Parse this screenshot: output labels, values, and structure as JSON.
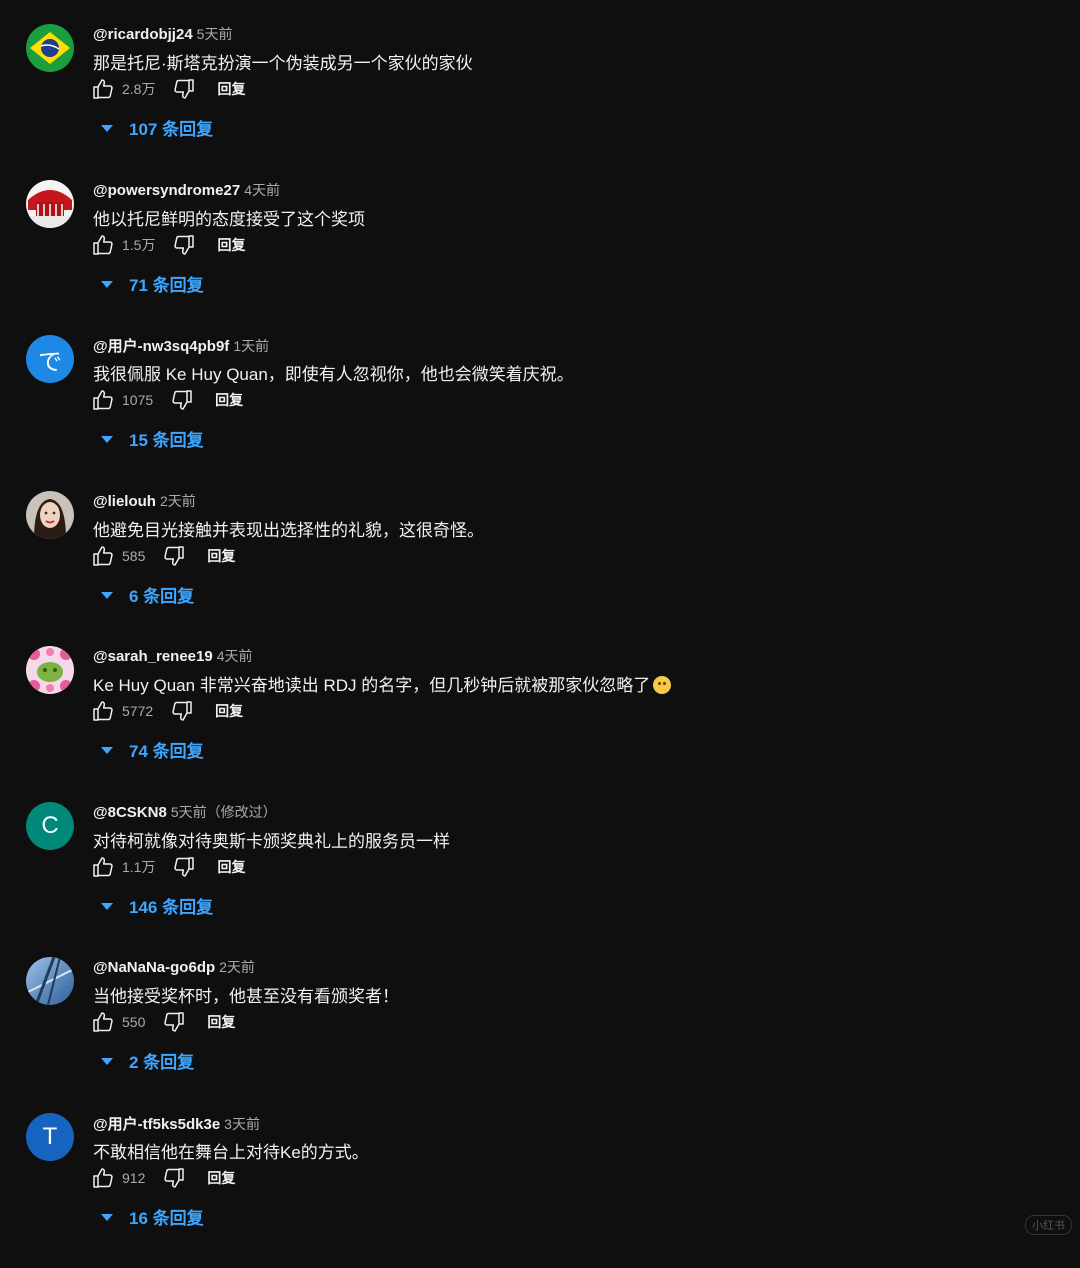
{
  "like_icon": "thumbs-up-icon",
  "dislike_icon": "thumbs-down-icon",
  "expand_icon": "caret-down-icon",
  "accent_color": "#3ea6ff",
  "background_color": "#0f0f0f",
  "watermark": "小红书",
  "comments": [
    {
      "author": "@ricardobjj24",
      "time": "5天前",
      "text": "那是托尼·斯塔克扮演一个伪装成另一个家伙的家伙",
      "likes": "2.8万",
      "reply_label": "回复",
      "replies_label": "107 条回复",
      "avatar": {
        "type": "brazil-flag"
      }
    },
    {
      "author": "@powersyndrome27",
      "time": "4天前",
      "text": "他以托尼鲜明的态度接受了这个奖项",
      "likes": "1.5万",
      "reply_label": "回复",
      "replies_label": "71 条回复",
      "avatar": {
        "type": "red-art"
      }
    },
    {
      "author": "@用户-nw3sq4pb9f",
      "time": "1天前",
      "text": "我很佩服 Ke Huy Quan，即使有人忽视你，他也会微笑着庆祝。",
      "likes": "1075",
      "reply_label": "回复",
      "replies_label": "15 条回复",
      "avatar": {
        "type": "letter",
        "letter": "で",
        "color": "#1e88e5"
      }
    },
    {
      "author": "@lielouh",
      "time": "2天前",
      "text": "他避免目光接触并表现出选择性的礼貌，这很奇怪。",
      "likes": "585",
      "reply_label": "回复",
      "replies_label": "6 条回复",
      "avatar": {
        "type": "portrait"
      }
    },
    {
      "author": "@sarah_renee19",
      "time": "4天前",
      "text": "Ke Huy Quan 非常兴奋地读出 RDJ 的名字，但几秒钟后就被那家伙忽略了",
      "has_emoji": true,
      "likes": "5772",
      "reply_label": "回复",
      "replies_label": "74 条回复",
      "avatar": {
        "type": "flowers"
      }
    },
    {
      "author": "@8CSKN8",
      "time": "5天前（修改过）",
      "text": "对待柯就像对待奥斯卡颁奖典礼上的服务员一样",
      "likes": "1.1万",
      "reply_label": "回复",
      "replies_label": "146 条回复",
      "avatar": {
        "type": "letter",
        "letter": "C",
        "color": "#00897b"
      }
    },
    {
      "author": "@NaNaNa-go6dp",
      "time": "2天前",
      "text": "当他接受奖杯时，他甚至没有看颁奖者！",
      "likes": "550",
      "reply_label": "回复",
      "replies_label": "2 条回复",
      "avatar": {
        "type": "sky"
      }
    },
    {
      "author": "@用户-tf5ks5dk3e",
      "time": "3天前",
      "text": "不敢相信他在舞台上对待Ke的方式。",
      "likes": "912",
      "reply_label": "回复",
      "replies_label": "16 条回复",
      "avatar": {
        "type": "letter",
        "letter": "T",
        "color": "#1565c0"
      }
    }
  ]
}
